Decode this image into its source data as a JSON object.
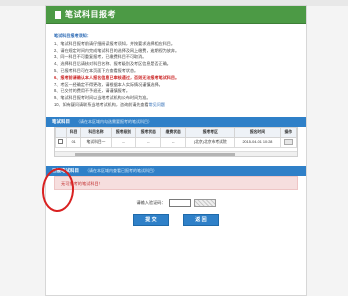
{
  "page": {
    "title": "笔试科目报考"
  },
  "notes": {
    "label": "笔试科目报考须知：",
    "items": [
      {
        "text": "1、笔试科目报考前请仔细阅读报考须知，并按要求选择相应科目。",
        "highlight": false
      },
      {
        "text": "2、请在规定时间内完成笔试科目的选择及网上缴费，逾期视为放弃。",
        "highlight": false
      },
      {
        "text": "3、同一科目不可重复报考，已缴费科目不可取消。",
        "highlight": false
      },
      {
        "text": "4、选择科目后请核对科目名称、报考级别及考区信息是否正确。",
        "highlight": false
      },
      {
        "text": "5、已报考科目可在本页面下方查看报考状态。",
        "highlight": false
      },
      {
        "text": "6、报考前请确认本人报名信息已审核通过，否则无法报考笔试科目。",
        "highlight": true
      },
      {
        "text": "7、考区一经确定不得更改，请根据本人实际情况谨慎选择。",
        "highlight": false
      },
      {
        "text": "8、已交付的费用不予退还，请谨慎报考。",
        "highlight": false
      },
      {
        "text": "9、笔试科目报考时间以当地考试机构公布时间为准。",
        "highlight": false
      },
      {
        "text": "10、如有疑问请联系当地考试机构，咨询前请先查看",
        "highlight": false
      }
    ],
    "link_text": "常见问题"
  },
  "section1": {
    "title": "笔试科目",
    "note": "（请在本区域内勾选需要报考的笔试科目）",
    "headers": [
      "",
      "科目",
      "科目名称",
      "报考级别",
      "报考状态",
      "缴费状态",
      "报考考区",
      "报名时间",
      "操作"
    ],
    "rows": [
      [
        "",
        "01",
        "笔试科目一",
        "--",
        "--",
        "--",
        "(北京)北京市考试院",
        "2015-04-01 10:28",
        ""
      ]
    ]
  },
  "section2": {
    "title": "已报笔试科目",
    "note": "（请在本区域内查看已报考的笔试科目）",
    "empty_text": "无可报考的笔试科目！"
  },
  "verify": {
    "label": "请输入验证码：",
    "value": ""
  },
  "actions": {
    "submit": "提 交",
    "back": "返 回"
  }
}
